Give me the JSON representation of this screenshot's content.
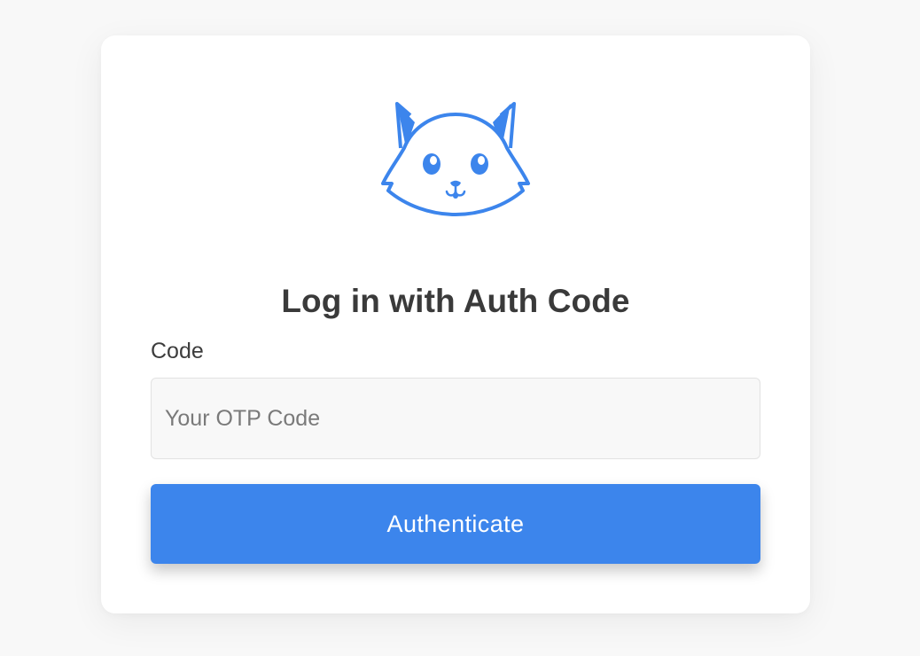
{
  "login": {
    "logo_icon": "cat-face-icon",
    "title": "Log in with Auth Code",
    "code_label": "Code",
    "code_value": "",
    "code_placeholder": "Your OTP Code",
    "submit_label": "Authenticate"
  },
  "colors": {
    "accent": "#3c85ec",
    "page_background": "#f8f8f8",
    "card_background": "#ffffff",
    "title_text": "#3a3a3a"
  }
}
